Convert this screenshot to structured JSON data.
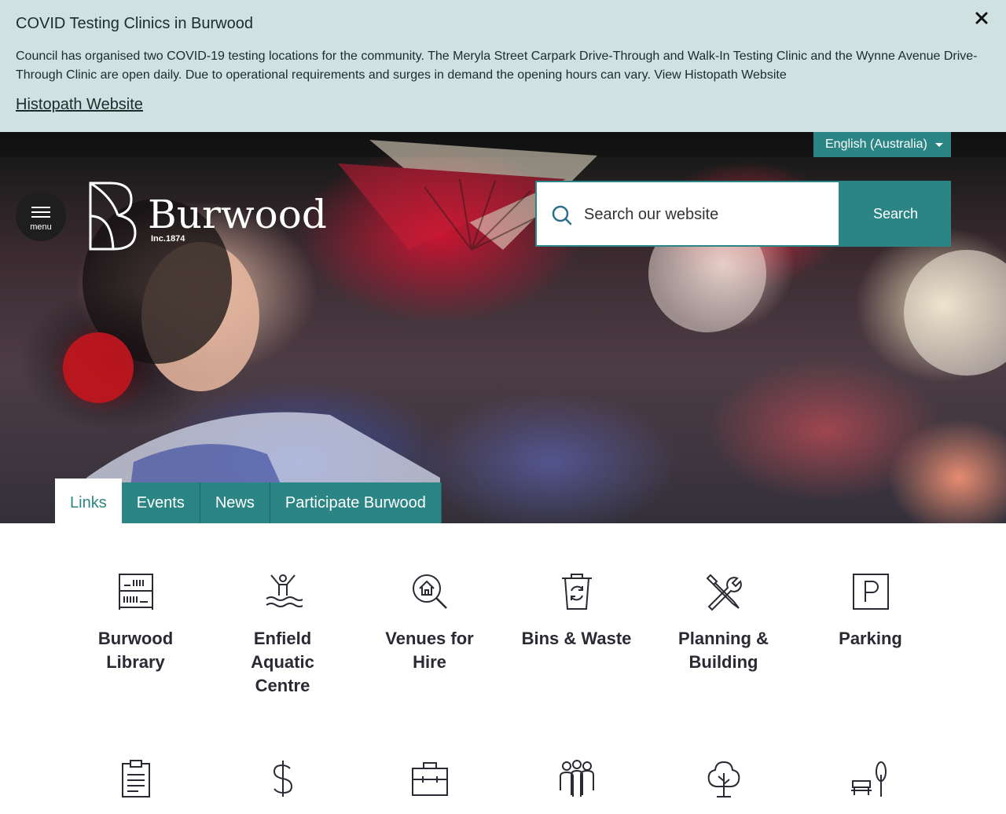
{
  "alert": {
    "title": "COVID Testing Clinics in Burwood",
    "body": "Council has organised two COVID-19 testing locations for the community. The Meryla Street Carpark Drive-Through and Walk-In Testing Clinic and the Wynne Avenue Drive-Through Clinic are open daily. Due to operational requirements and surges in demand the opening hours can vary. View Histopath Website",
    "link_label": "Histopath Website",
    "close_icon": "close-icon"
  },
  "header": {
    "language": "English (Australia)",
    "menu_label": "menu",
    "logo_word": "Burwood",
    "logo_inc": "Inc.1874",
    "search_placeholder": "Search our website",
    "search_button": "Search"
  },
  "tabs": [
    {
      "label": "Links",
      "active": true
    },
    {
      "label": "Events",
      "active": false
    },
    {
      "label": "News",
      "active": false
    },
    {
      "label": "Participate Burwood",
      "active": false
    }
  ],
  "quick_links": [
    {
      "label": "Burwood Library",
      "icon": "library-icon"
    },
    {
      "label": "Enfield Aquatic Centre",
      "icon": "swimmer-icon"
    },
    {
      "label": "Venues for Hire",
      "icon": "venue-search-icon"
    },
    {
      "label": "Bins & Waste",
      "icon": "recycle-bin-icon"
    },
    {
      "label": "Planning & Building",
      "icon": "tools-icon"
    },
    {
      "label": "Parking",
      "icon": "parking-icon"
    },
    {
      "label": "",
      "icon": "clipboard-icon"
    },
    {
      "label": "",
      "icon": "dollar-icon"
    },
    {
      "label": "",
      "icon": "briefcase-icon"
    },
    {
      "label": "",
      "icon": "community-icon"
    },
    {
      "label": "",
      "icon": "tree-icon"
    },
    {
      "label": "",
      "icon": "park-bench-icon"
    }
  ],
  "colors": {
    "teal": "#2c8585",
    "alert_bg": "#cfe2e1",
    "text_dark": "#2a2a34"
  }
}
